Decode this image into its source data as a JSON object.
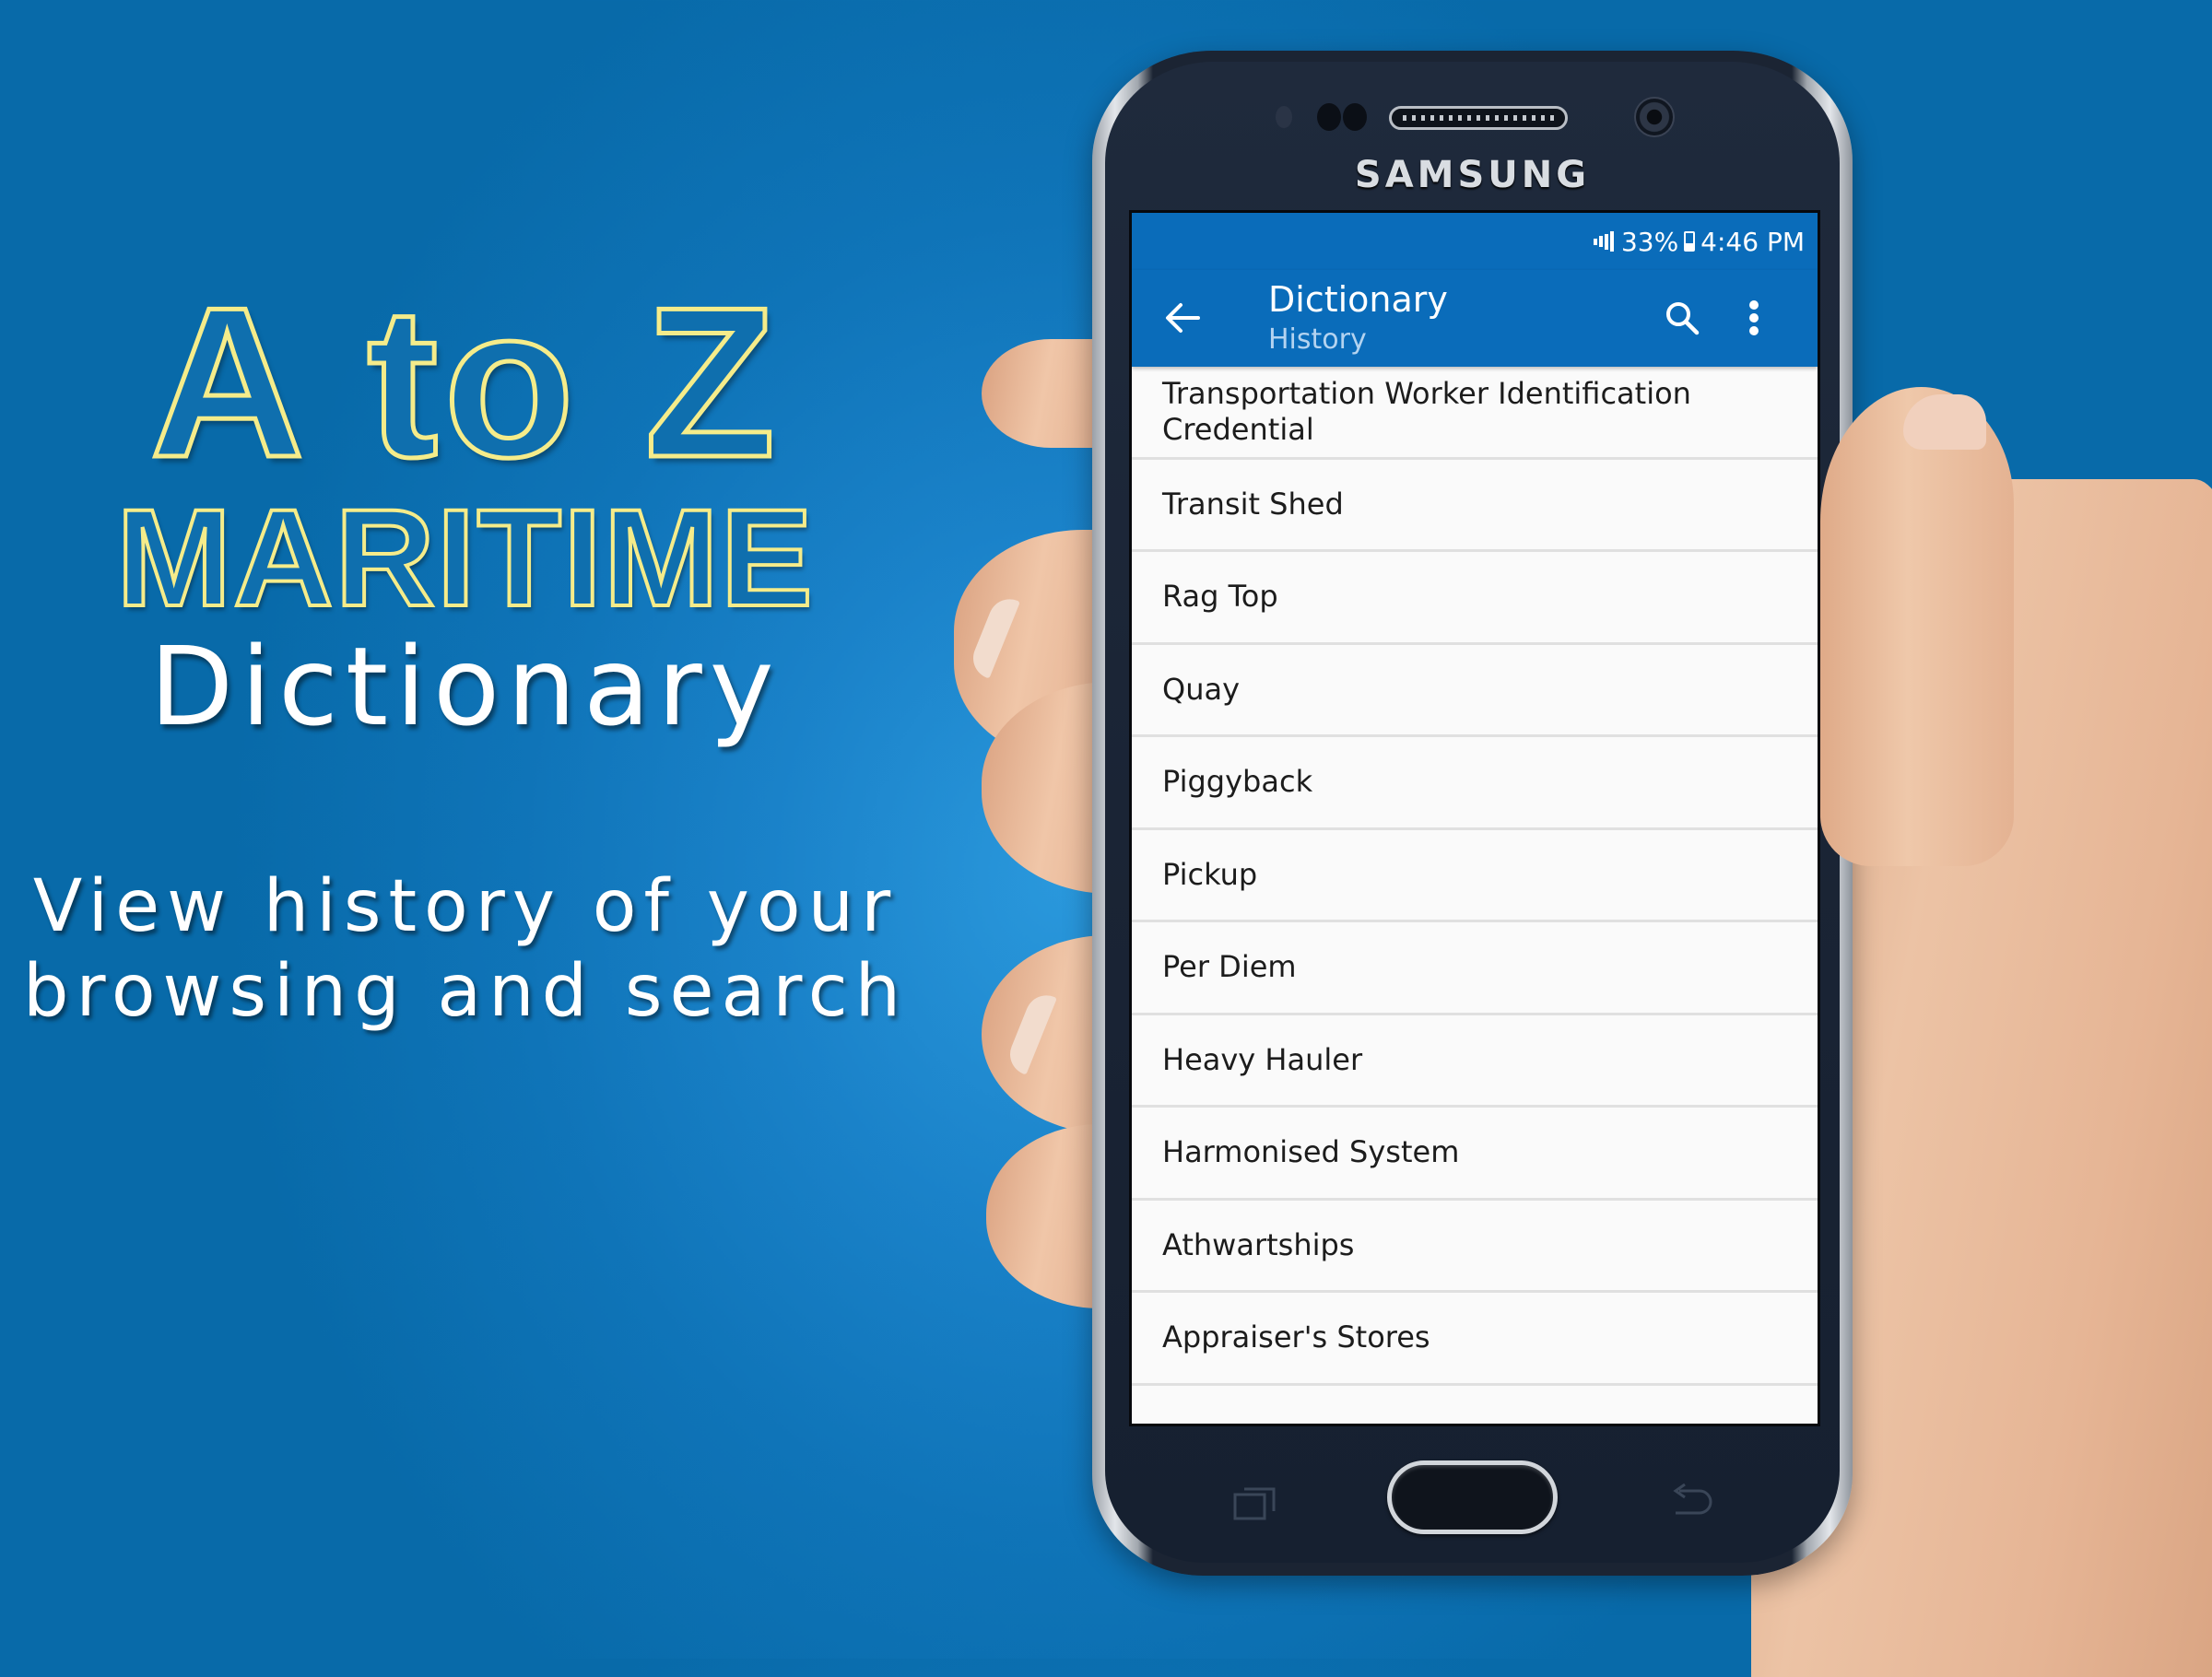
{
  "promo": {
    "title_line1": "A to Z",
    "title_line2": "MARITIME",
    "title_line3": "Dictionary",
    "tagline_line1": "View history of your",
    "tagline_line2": "browsing and search"
  },
  "device": {
    "brand": "SAMSUNG"
  },
  "status_bar": {
    "signal_icon": "signal-bars-icon",
    "battery_percent": "33%",
    "battery_icon": "battery-charging-icon",
    "time": "4:46 PM"
  },
  "app_bar": {
    "back_icon": "arrow-left-icon",
    "title": "Dictionary",
    "subtitle": "History",
    "search_icon": "search-icon",
    "more_icon": "more-vertical-icon"
  },
  "history": {
    "items": [
      "Transportation Worker Identification Credential",
      "Transit Shed",
      "Rag Top",
      "Quay",
      "Piggyback",
      "Pickup",
      "Per Diem",
      "Heavy Hauler",
      "Harmonised System",
      "Athwartships",
      "Appraiser's Stores"
    ]
  },
  "nav_keys": {
    "recent_icon": "recent-apps-icon",
    "home": "home-button",
    "back_icon": "back-key-icon"
  },
  "colors": {
    "background": "#086DAC",
    "app_bar": "#0A6CBA",
    "title_outline": "#F5EC8A",
    "list_bg": "#FAFAFA",
    "divider": "#E0E0E0",
    "subtitle": "#B3D3F0"
  }
}
